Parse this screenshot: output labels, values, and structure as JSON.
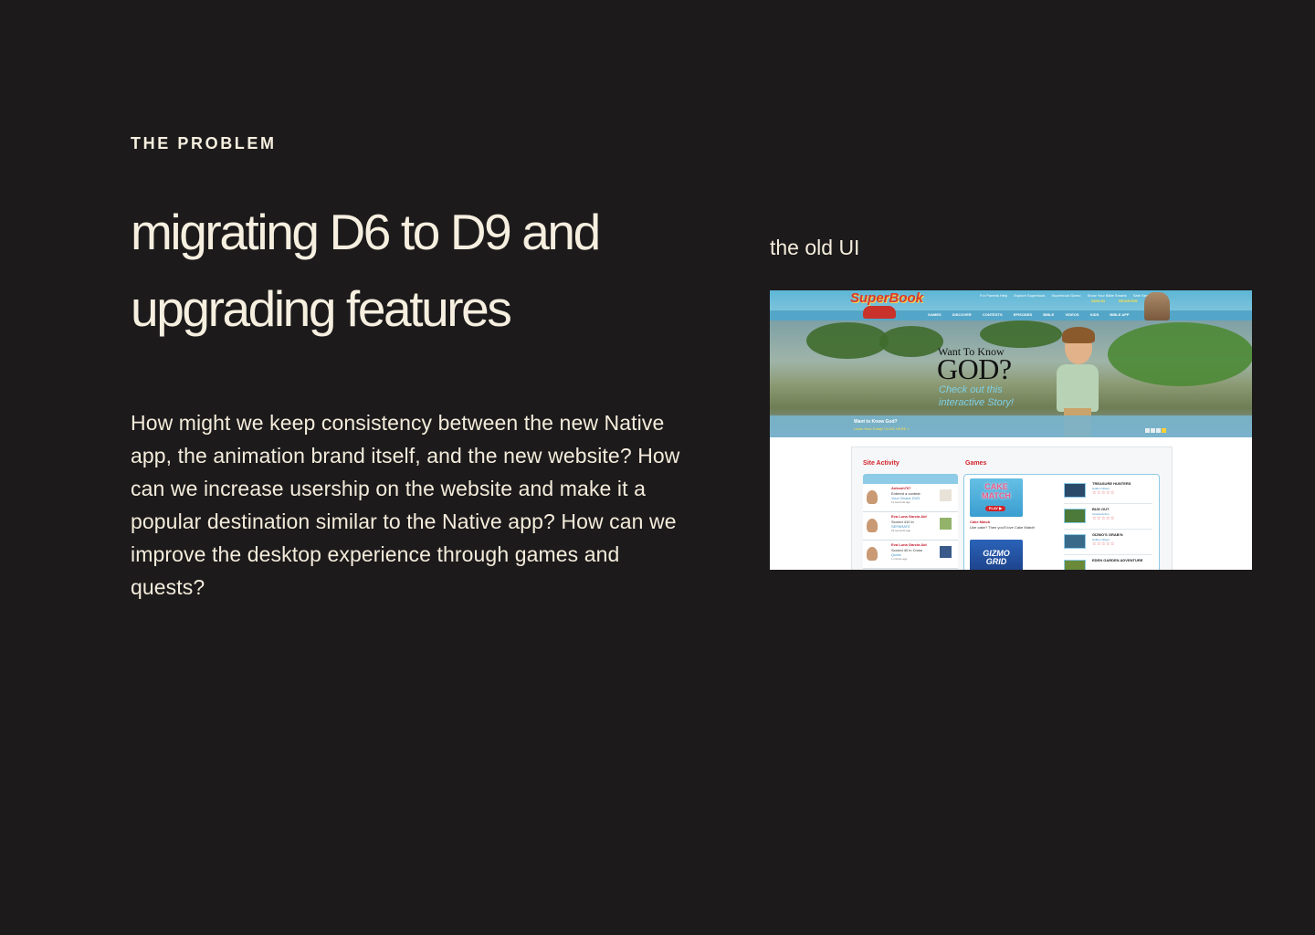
{
  "section": {
    "eyebrow": "THE PROBLEM",
    "headline": "migrating D6 to D9 and upgrading features",
    "body": "How might we keep consistency between the new Native app, the animation brand itself, and the new website? How can we increase usership on the website and make it a popular destination similar to the Native app? How can we improve the desktop experience through games and quests?",
    "caption": "the old UI"
  },
  "old_ui": {
    "logo": "SuperBook",
    "util_links": [
      "For Parents Help",
      "Explore Superbook",
      "Superbook Gizmo",
      "Show Your Bible Smarts",
      "Safe Search"
    ],
    "login": [
      "SIGN IN",
      "REGISTER"
    ],
    "nav": [
      "GAMES",
      "DISCOVER",
      "CONTESTS",
      "EPISODES",
      "BIBLE",
      "VIDEOS",
      "KIDS",
      "BIBLE APP"
    ],
    "hero": {
      "line1": "Want To Know",
      "line2": "GOD?",
      "line3": "Check out this",
      "line4": "interactive Story!",
      "bar_question": "Want to Know God?",
      "bar_cta": "Learn How Today!  CLICK HERE »"
    },
    "site_activity_title": "Site Activity",
    "games_title": "Games",
    "activity": [
      {
        "name": "Ankush707",
        "line2": "Entered a contest:",
        "line3": "Your Choice DVD",
        "line4": "11 seconds ago"
      },
      {
        "name": "Eva Luna Garcia Ald",
        "line2": "Scored 410 in",
        "line3": "SEPARATE",
        "line4": "23 seconds ago"
      },
      {
        "name": "Eva Luna Garcia Ald",
        "line2": "Scored 40 in Cross",
        "line3": "Quest",
        "line4": "1 minute ago"
      }
    ],
    "featured_game": {
      "title": "CAKE MATCH",
      "play": "PLAY ▶",
      "name": "Cake Match",
      "desc": "Like cake? Then you'll love Cake Match!"
    },
    "featured_game2": {
      "title": "GIZMO GRID"
    },
    "game_list": [
      {
        "name": "TREASURE HUNTERS",
        "cat": "Hidden Object",
        "stars": "☆☆☆☆☆"
      },
      {
        "name": "BUG OUT",
        "cat": "Arcade/Action",
        "stars": "☆☆☆☆☆"
      },
      {
        "name": "GIZMO'S GRAB'N",
        "cat": "Hidden Object",
        "stars": "☆☆☆☆☆"
      },
      {
        "name": "EDEN GARDEN ADVENTURE",
        "cat": "",
        "stars": ""
      }
    ]
  }
}
